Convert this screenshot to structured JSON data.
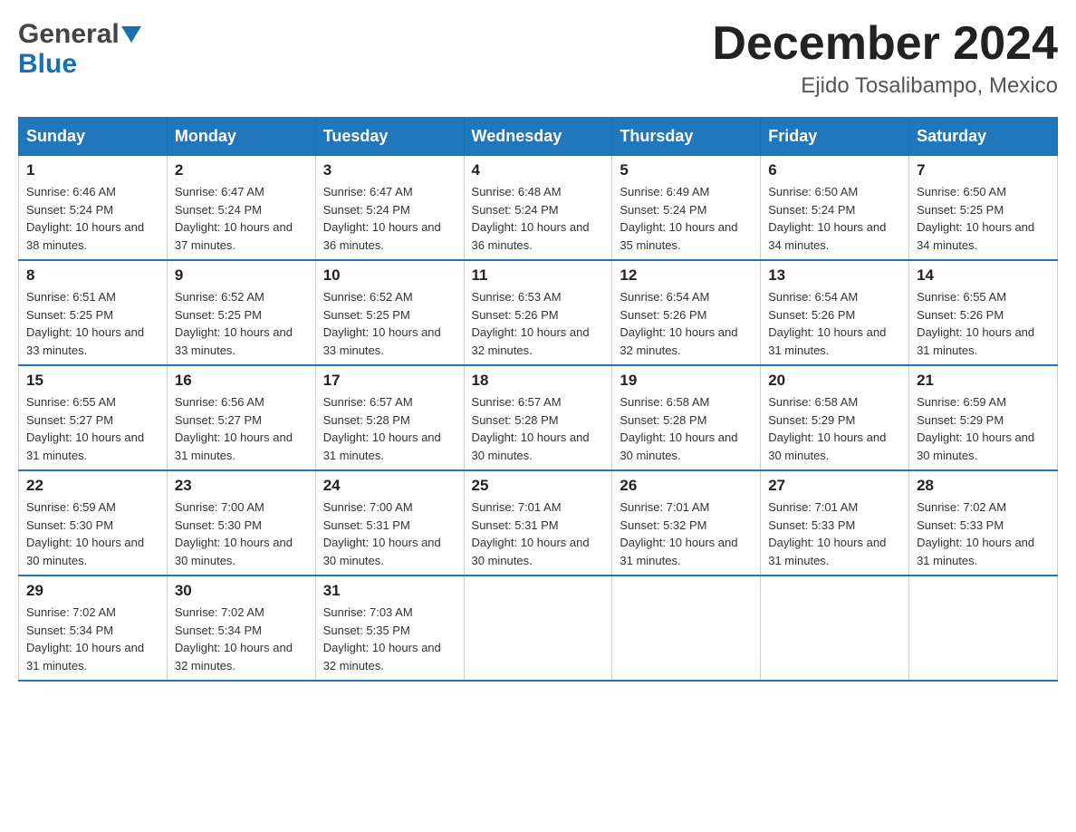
{
  "header": {
    "logo_general": "General",
    "logo_blue": "Blue",
    "title": "December 2024",
    "subtitle": "Ejido Tosalibampo, Mexico"
  },
  "days_of_week": [
    "Sunday",
    "Monday",
    "Tuesday",
    "Wednesday",
    "Thursday",
    "Friday",
    "Saturday"
  ],
  "weeks": [
    [
      {
        "day": "1",
        "sunrise": "6:46 AM",
        "sunset": "5:24 PM",
        "daylight": "10 hours and 38 minutes."
      },
      {
        "day": "2",
        "sunrise": "6:47 AM",
        "sunset": "5:24 PM",
        "daylight": "10 hours and 37 minutes."
      },
      {
        "day": "3",
        "sunrise": "6:47 AM",
        "sunset": "5:24 PM",
        "daylight": "10 hours and 36 minutes."
      },
      {
        "day": "4",
        "sunrise": "6:48 AM",
        "sunset": "5:24 PM",
        "daylight": "10 hours and 36 minutes."
      },
      {
        "day": "5",
        "sunrise": "6:49 AM",
        "sunset": "5:24 PM",
        "daylight": "10 hours and 35 minutes."
      },
      {
        "day": "6",
        "sunrise": "6:50 AM",
        "sunset": "5:24 PM",
        "daylight": "10 hours and 34 minutes."
      },
      {
        "day": "7",
        "sunrise": "6:50 AM",
        "sunset": "5:25 PM",
        "daylight": "10 hours and 34 minutes."
      }
    ],
    [
      {
        "day": "8",
        "sunrise": "6:51 AM",
        "sunset": "5:25 PM",
        "daylight": "10 hours and 33 minutes."
      },
      {
        "day": "9",
        "sunrise": "6:52 AM",
        "sunset": "5:25 PM",
        "daylight": "10 hours and 33 minutes."
      },
      {
        "day": "10",
        "sunrise": "6:52 AM",
        "sunset": "5:25 PM",
        "daylight": "10 hours and 33 minutes."
      },
      {
        "day": "11",
        "sunrise": "6:53 AM",
        "sunset": "5:26 PM",
        "daylight": "10 hours and 32 minutes."
      },
      {
        "day": "12",
        "sunrise": "6:54 AM",
        "sunset": "5:26 PM",
        "daylight": "10 hours and 32 minutes."
      },
      {
        "day": "13",
        "sunrise": "6:54 AM",
        "sunset": "5:26 PM",
        "daylight": "10 hours and 31 minutes."
      },
      {
        "day": "14",
        "sunrise": "6:55 AM",
        "sunset": "5:26 PM",
        "daylight": "10 hours and 31 minutes."
      }
    ],
    [
      {
        "day": "15",
        "sunrise": "6:55 AM",
        "sunset": "5:27 PM",
        "daylight": "10 hours and 31 minutes."
      },
      {
        "day": "16",
        "sunrise": "6:56 AM",
        "sunset": "5:27 PM",
        "daylight": "10 hours and 31 minutes."
      },
      {
        "day": "17",
        "sunrise": "6:57 AM",
        "sunset": "5:28 PM",
        "daylight": "10 hours and 31 minutes."
      },
      {
        "day": "18",
        "sunrise": "6:57 AM",
        "sunset": "5:28 PM",
        "daylight": "10 hours and 30 minutes."
      },
      {
        "day": "19",
        "sunrise": "6:58 AM",
        "sunset": "5:28 PM",
        "daylight": "10 hours and 30 minutes."
      },
      {
        "day": "20",
        "sunrise": "6:58 AM",
        "sunset": "5:29 PM",
        "daylight": "10 hours and 30 minutes."
      },
      {
        "day": "21",
        "sunrise": "6:59 AM",
        "sunset": "5:29 PM",
        "daylight": "10 hours and 30 minutes."
      }
    ],
    [
      {
        "day": "22",
        "sunrise": "6:59 AM",
        "sunset": "5:30 PM",
        "daylight": "10 hours and 30 minutes."
      },
      {
        "day": "23",
        "sunrise": "7:00 AM",
        "sunset": "5:30 PM",
        "daylight": "10 hours and 30 minutes."
      },
      {
        "day": "24",
        "sunrise": "7:00 AM",
        "sunset": "5:31 PM",
        "daylight": "10 hours and 30 minutes."
      },
      {
        "day": "25",
        "sunrise": "7:01 AM",
        "sunset": "5:31 PM",
        "daylight": "10 hours and 30 minutes."
      },
      {
        "day": "26",
        "sunrise": "7:01 AM",
        "sunset": "5:32 PM",
        "daylight": "10 hours and 31 minutes."
      },
      {
        "day": "27",
        "sunrise": "7:01 AM",
        "sunset": "5:33 PM",
        "daylight": "10 hours and 31 minutes."
      },
      {
        "day": "28",
        "sunrise": "7:02 AM",
        "sunset": "5:33 PM",
        "daylight": "10 hours and 31 minutes."
      }
    ],
    [
      {
        "day": "29",
        "sunrise": "7:02 AM",
        "sunset": "5:34 PM",
        "daylight": "10 hours and 31 minutes."
      },
      {
        "day": "30",
        "sunrise": "7:02 AM",
        "sunset": "5:34 PM",
        "daylight": "10 hours and 32 minutes."
      },
      {
        "day": "31",
        "sunrise": "7:03 AM",
        "sunset": "5:35 PM",
        "daylight": "10 hours and 32 minutes."
      },
      null,
      null,
      null,
      null
    ]
  ]
}
